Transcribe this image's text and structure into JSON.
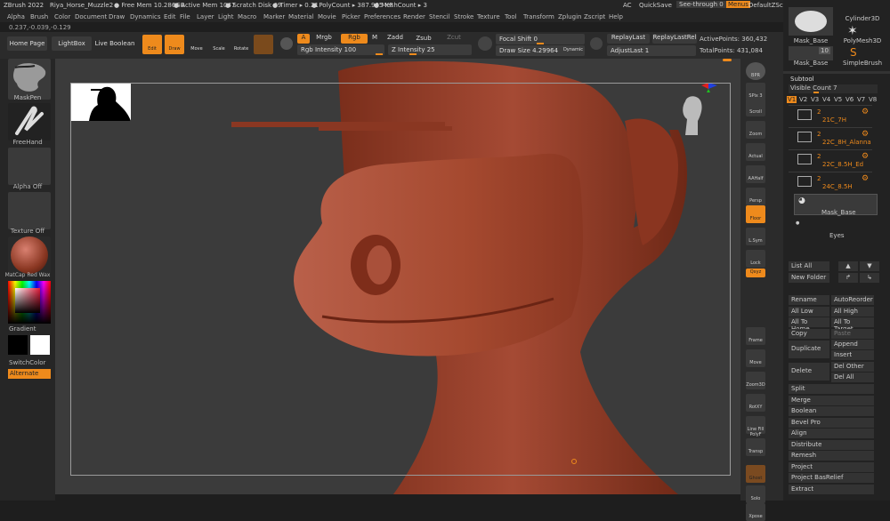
{
  "titlebar": {
    "app": "ZBrush 2022",
    "file": "Riya_Horse_Muzzle2",
    "free_mem": "● Free Mem 10.286GB",
    "active_mem": "● Active Mem 1047",
    "scratch": "● Scratch Disk 49",
    "timer": "● Timer ▸ 0.21",
    "polycount": "● PolyCount ▸ 387.905 KP",
    "meshcount": "● MeshCount ▸ 3",
    "ac": "AC",
    "quicksave": "QuickSave",
    "seethrough": "See-through  0",
    "menus": "Menus",
    "script": "DefaultZScript"
  },
  "menubar": [
    "Alpha",
    "Brush",
    "Color",
    "Document",
    "Draw",
    "Dynamics",
    "Edit",
    "File",
    "Layer",
    "Light",
    "Macro",
    "Marker",
    "Material",
    "Movie",
    "Picker",
    "Preferences",
    "Render",
    "Stencil",
    "Stroke",
    "Texture",
    "Tool",
    "Transform",
    "Zplugin",
    "Zscript",
    "Help"
  ],
  "coord": "0.237,-0.039,-0.129",
  "toolbar": {
    "home": "Home Page",
    "lightbox": "LightBox",
    "liveboolean": "Live Boolean",
    "edit": "Edit",
    "draw": "Draw",
    "move": "Move",
    "scale": "Scale",
    "rotate": "Rotate",
    "a": "A",
    "mrgb": "Mrgb",
    "rgb": "Rgb",
    "m": "M",
    "zadd": "Zadd",
    "zsub": "Zsub",
    "zcut": "Zcut",
    "rgb_intensity": "Rgb Intensity 100",
    "z_intensity": "Z Intensity 25",
    "focal_shift": "Focal Shift 0",
    "draw_size": "Draw Size 4.29964",
    "dynamic": "Dynamic",
    "replaylast": "ReplayLast",
    "replaylastrel": "ReplayLastRel",
    "adjustlast": "AdjustLast 1",
    "activepoints": "ActivePoints: 360,432",
    "totalpoints": "TotalPoints: 431,084"
  },
  "leftpanel": {
    "brush": "MaskPen",
    "stroke": "FreeHand",
    "alpha": "Alpha Off",
    "texture": "Texture Off",
    "material": "MatCap Red Wax",
    "gradient": "Gradient",
    "switchcolor": "SwitchColor",
    "alternate": "Alternate"
  },
  "rightnav": [
    "BPR",
    "SPix 3",
    "Scroll",
    "Zoom",
    "Actual",
    "AAHalf",
    "Persp",
    "Floor",
    "L.Sym",
    "Lock",
    "Qxyz",
    "",
    "",
    "Frame",
    "Move",
    "Zoom3D",
    "RotXY",
    "Line Fill PolyF",
    "Transp",
    "Ghost",
    "Solo",
    "Xpose"
  ],
  "rightpanel": {
    "cylinder": "Cylinder3D",
    "mask_base_top": "Mask_Base",
    "polymesh": "PolyMesh3D",
    "mask_base": "Mask_Base",
    "count": "10",
    "simplebrush": "SimpleBrush",
    "subtool_title": "Subtool",
    "visible_count": "Visible Count  7",
    "versions": [
      "V1",
      "V2",
      "V3",
      "V4",
      "V5",
      "V6",
      "V7",
      "V8"
    ],
    "subtools": [
      {
        "num": "2",
        "name": "21C_7H"
      },
      {
        "num": "2",
        "name": "22C_8H_Alanna"
      },
      {
        "num": "2",
        "name": "22C_8.5H_Ed"
      },
      {
        "num": "2",
        "name": "24C_8.5H"
      }
    ],
    "selected": "Mask_Base",
    "eyes": "Eyes",
    "buttons": {
      "listall": "List All",
      "newfolder": "New Folder",
      "rename": "Rename",
      "autoreorder": "AutoReorder",
      "alllow": "All Low",
      "allhigh": "All High",
      "alltohome": "All To Home",
      "alltotarget": "All To Target",
      "copy": "Copy",
      "paste": "Paste",
      "duplicate": "Duplicate",
      "append": "Append",
      "insert": "Insert",
      "delete": "Delete",
      "delother": "Del Other",
      "delall": "Del All",
      "split": "Split",
      "merge": "Merge",
      "boolean": "Boolean",
      "bevelpro": "Bevel Pro",
      "align": "Align",
      "distribute": "Distribute",
      "remesh": "Remesh",
      "project": "Project",
      "projectbasrelief": "Project BasRelief",
      "extract": "Extract"
    }
  },
  "colors": {
    "accent": "#ee8a1c",
    "model": "#8a3722",
    "model_light": "#a9503a",
    "canvas": "#3b3b3b"
  }
}
